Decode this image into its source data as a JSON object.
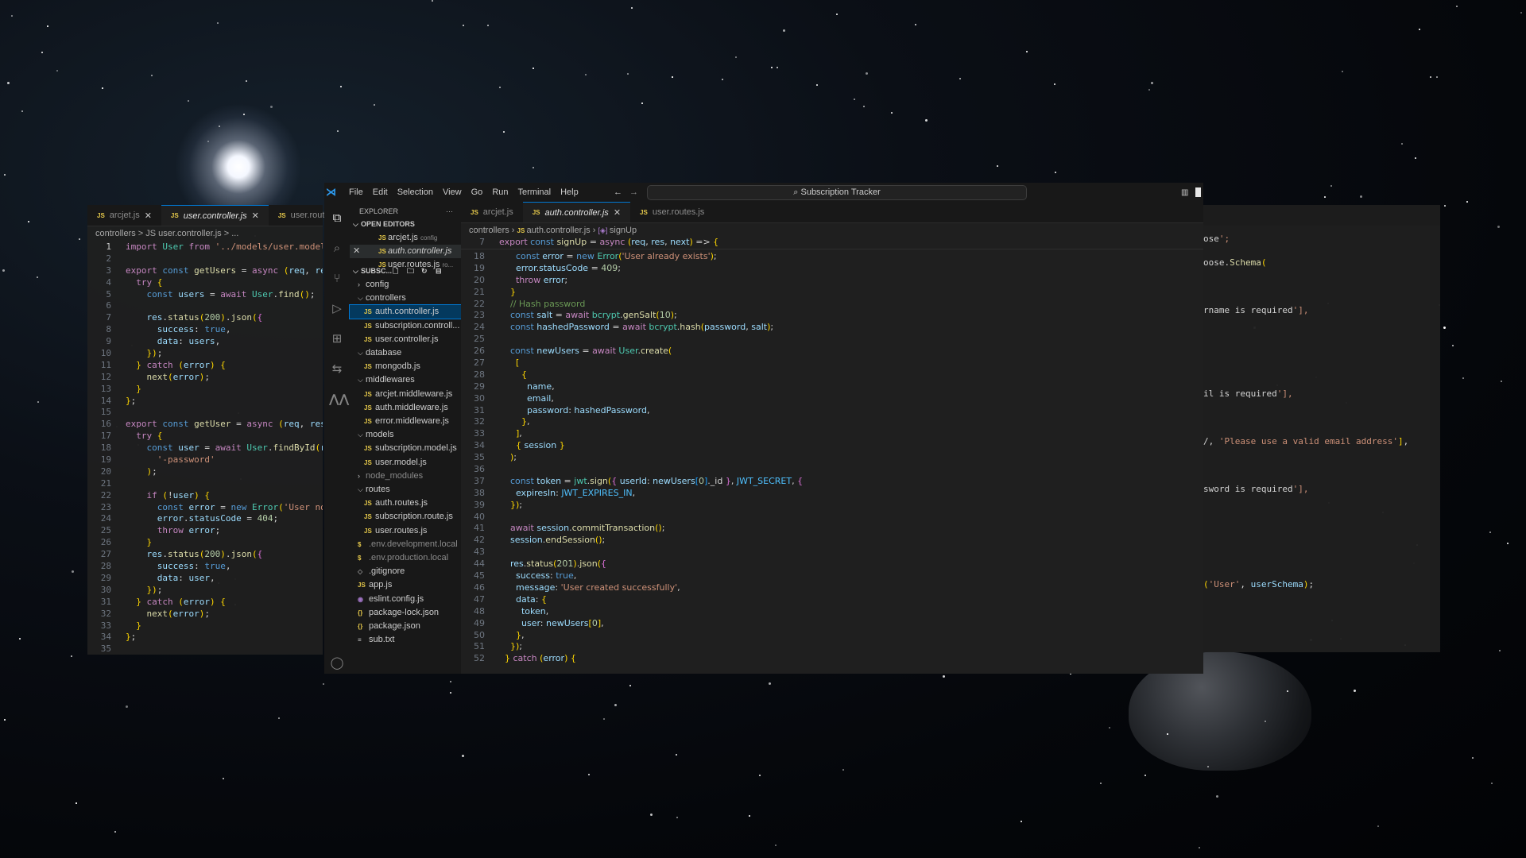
{
  "left_pane": {
    "tabs": [
      {
        "label": "arcjet.js",
        "close": "✕",
        "active": false
      },
      {
        "label": "user.controller.js",
        "close": "✕",
        "active": true
      },
      {
        "label": "user.routes.js",
        "active": false
      }
    ],
    "breadcrumb": "controllers  >  JS user.controller.js  >  ...",
    "lines": [
      {
        "n": "1",
        "t": "import User from '../models/user.model.js"
      },
      {
        "n": "2",
        "t": ""
      },
      {
        "n": "3",
        "t": "export const getUsers = async (req, res,"
      },
      {
        "n": "4",
        "t": "  try {"
      },
      {
        "n": "5",
        "t": "    const users = await User.find();"
      },
      {
        "n": "6",
        "t": ""
      },
      {
        "n": "7",
        "t": "    res.status(200).json({"
      },
      {
        "n": "8",
        "t": "      success: true,"
      },
      {
        "n": "9",
        "t": "      data: users,"
      },
      {
        "n": "10",
        "t": "    });"
      },
      {
        "n": "11",
        "t": "  } catch (error) {"
      },
      {
        "n": "12",
        "t": "    next(error);"
      },
      {
        "n": "13",
        "t": "  }"
      },
      {
        "n": "14",
        "t": "};"
      },
      {
        "n": "15",
        "t": ""
      },
      {
        "n": "16",
        "t": "export const getUser = async (req, res, n"
      },
      {
        "n": "17",
        "t": "  try {"
      },
      {
        "n": "18",
        "t": "    const user = await User.findById(req."
      },
      {
        "n": "19",
        "t": "      '-password'"
      },
      {
        "n": "20",
        "t": "    );"
      },
      {
        "n": "21",
        "t": ""
      },
      {
        "n": "22",
        "t": "    if (!user) {"
      },
      {
        "n": "23",
        "t": "      const error = new Error('User not f"
      },
      {
        "n": "24",
        "t": "      error.statusCode = 404;"
      },
      {
        "n": "25",
        "t": "      throw error;"
      },
      {
        "n": "26",
        "t": "    }"
      },
      {
        "n": "27",
        "t": "    res.status(200).json({"
      },
      {
        "n": "28",
        "t": "      success: true,"
      },
      {
        "n": "29",
        "t": "      data: user,"
      },
      {
        "n": "30",
        "t": "    });"
      },
      {
        "n": "31",
        "t": "  } catch (error) {"
      },
      {
        "n": "32",
        "t": "    next(error);"
      },
      {
        "n": "33",
        "t": "  }"
      },
      {
        "n": "34",
        "t": "};"
      },
      {
        "n": "35",
        "t": ""
      }
    ]
  },
  "right_pane": {
    "lines": [
      {
        "t": "ose';"
      },
      {
        "t": "oose.Schema("
      },
      {
        "t": "rname is required'],"
      },
      {
        "t": "il is required'],"
      },
      {
        "t": "/, 'Please use a valid email address'],"
      },
      {
        "t": "sword is required'],"
      },
      {
        "t": "('User', userSchema);"
      }
    ]
  },
  "window": {
    "menu": [
      "File",
      "Edit",
      "Selection",
      "View",
      "Go",
      "Run",
      "Terminal",
      "Help"
    ],
    "nav_back": "←",
    "nav_forward": "→",
    "search_label": "Subscription Tracker",
    "activity_icons": [
      "files-icon",
      "search-icon",
      "source-control-icon",
      "run-debug-icon",
      "extensions-icon",
      "remote-icon",
      "wave-icon",
      "account-icon"
    ],
    "explorer": {
      "header": "EXPLORER",
      "more": "···",
      "open_editors_label": "OPEN EDITORS",
      "open_editors": [
        {
          "name": "arcjet.js",
          "hint": "config"
        },
        {
          "name": "auth.controller.js",
          "hint": ""
        },
        {
          "name": "user.routes.js",
          "hint": "ro..."
        }
      ],
      "project_label": "SUBSC...",
      "tree": [
        {
          "name": "config",
          "type": "folder",
          "open": false,
          "depth": 1
        },
        {
          "name": "controllers",
          "type": "folder",
          "open": true,
          "depth": 1
        },
        {
          "name": "auth.controller.js",
          "type": "js",
          "depth": 2,
          "selected": true
        },
        {
          "name": "subscription.controll...",
          "type": "js",
          "depth": 2
        },
        {
          "name": "user.controller.js",
          "type": "js",
          "depth": 2
        },
        {
          "name": "database",
          "type": "folder",
          "open": true,
          "depth": 1
        },
        {
          "name": "mongodb.js",
          "type": "js",
          "depth": 2
        },
        {
          "name": "middlewares",
          "type": "folder",
          "open": true,
          "depth": 1
        },
        {
          "name": "arcjet.middleware.js",
          "type": "js",
          "depth": 2
        },
        {
          "name": "auth.middleware.js",
          "type": "js",
          "depth": 2
        },
        {
          "name": "error.middleware.js",
          "type": "js",
          "depth": 2
        },
        {
          "name": "models",
          "type": "folder",
          "open": true,
          "depth": 1
        },
        {
          "name": "subscription.model.js",
          "type": "js",
          "depth": 2
        },
        {
          "name": "user.model.js",
          "type": "js",
          "depth": 2
        },
        {
          "name": "node_modules",
          "type": "folder",
          "open": false,
          "depth": 1,
          "dim": true
        },
        {
          "name": "routes",
          "type": "folder",
          "open": true,
          "depth": 1
        },
        {
          "name": "auth.routes.js",
          "type": "js",
          "depth": 2
        },
        {
          "name": "subscription.route.js",
          "type": "js",
          "depth": 2
        },
        {
          "name": "user.routes.js",
          "type": "js",
          "depth": 2
        },
        {
          "name": ".env.development.local",
          "type": "env",
          "depth": 1,
          "dim": true
        },
        {
          "name": ".env.production.local",
          "type": "env",
          "depth": 1,
          "dim": true
        },
        {
          "name": ".gitignore",
          "type": "git",
          "depth": 1
        },
        {
          "name": "app.js",
          "type": "js",
          "depth": 1
        },
        {
          "name": "eslint.config.js",
          "type": "eslint",
          "depth": 1
        },
        {
          "name": "package-lock.json",
          "type": "json",
          "depth": 1
        },
        {
          "name": "package.json",
          "type": "json",
          "depth": 1
        },
        {
          "name": "sub.txt",
          "type": "txt",
          "depth": 1
        }
      ]
    },
    "editor": {
      "tabs": [
        {
          "label": "arcjet.js",
          "active": false
        },
        {
          "label": "auth.controller.js",
          "active": true,
          "close": "✕"
        },
        {
          "label": "user.routes.js",
          "active": false
        }
      ],
      "breadcrumb": [
        "controllers",
        "auth.controller.js",
        "signUp"
      ],
      "sticky": {
        "n": "7",
        "t": "export const signUp = async (req, res, next) => {"
      },
      "lines": [
        {
          "n": "18",
          "t": "      const error = new Error('User already exists');"
        },
        {
          "n": "19",
          "t": "      error.statusCode = 409;"
        },
        {
          "n": "20",
          "t": "      throw error;"
        },
        {
          "n": "21",
          "t": "    }"
        },
        {
          "n": "22",
          "t": "    // Hash password"
        },
        {
          "n": "23",
          "t": "    const salt = await bcrypt.genSalt(10);"
        },
        {
          "n": "24",
          "t": "    const hashedPassword = await bcrypt.hash(password, salt);"
        },
        {
          "n": "25",
          "t": ""
        },
        {
          "n": "26",
          "t": "    const newUsers = await User.create("
        },
        {
          "n": "27",
          "t": "      ["
        },
        {
          "n": "28",
          "t": "        {"
        },
        {
          "n": "29",
          "t": "          name,"
        },
        {
          "n": "30",
          "t": "          email,"
        },
        {
          "n": "31",
          "t": "          password: hashedPassword,"
        },
        {
          "n": "32",
          "t": "        },"
        },
        {
          "n": "33",
          "t": "      ],"
        },
        {
          "n": "34",
          "t": "      { session }"
        },
        {
          "n": "35",
          "t": "    );"
        },
        {
          "n": "36",
          "t": ""
        },
        {
          "n": "37",
          "t": "    const token = jwt.sign({ userId: newUsers[0]._id }, JWT_SECRET, {"
        },
        {
          "n": "38",
          "t": "      expiresIn: JWT_EXPIRES_IN,"
        },
        {
          "n": "39",
          "t": "    });"
        },
        {
          "n": "40",
          "t": ""
        },
        {
          "n": "41",
          "t": "    await session.commitTransaction();"
        },
        {
          "n": "42",
          "t": "    session.endSession();"
        },
        {
          "n": "43",
          "t": ""
        },
        {
          "n": "44",
          "t": "    res.status(201).json({"
        },
        {
          "n": "45",
          "t": "      success: true,"
        },
        {
          "n": "46",
          "t": "      message: 'User created successfully',"
        },
        {
          "n": "47",
          "t": "      data: {"
        },
        {
          "n": "48",
          "t": "        token,"
        },
        {
          "n": "49",
          "t": "        user: newUsers[0],"
        },
        {
          "n": "50",
          "t": "      },"
        },
        {
          "n": "51",
          "t": "    });"
        },
        {
          "n": "52",
          "t": "  } catch (error) {"
        }
      ]
    }
  }
}
